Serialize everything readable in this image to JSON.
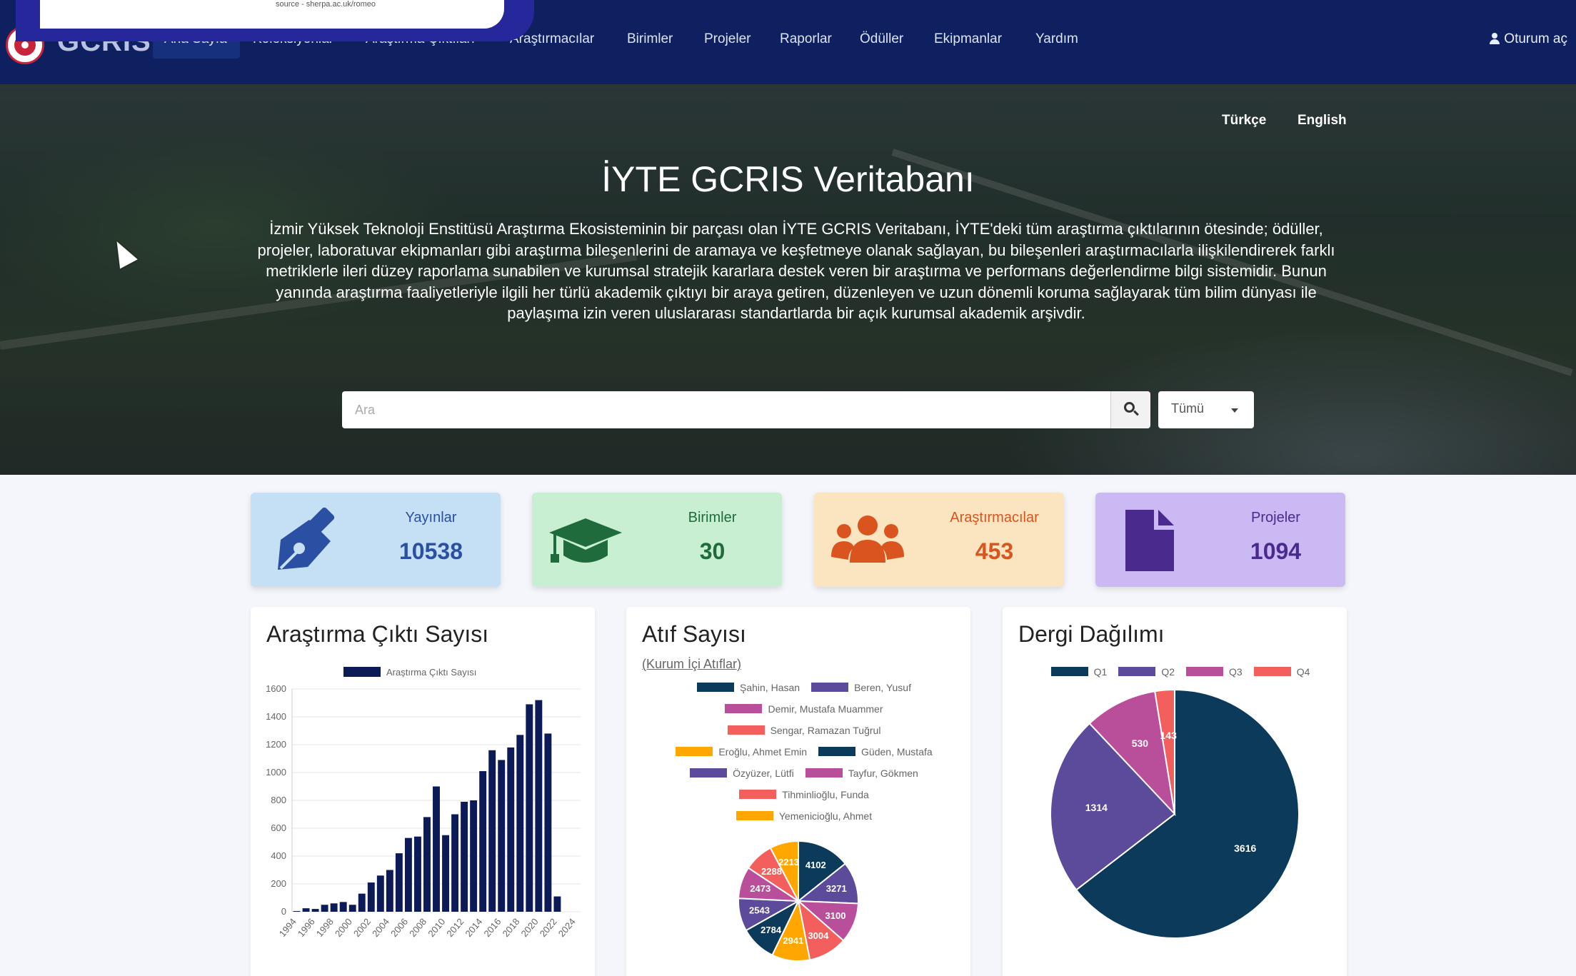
{
  "navbar": {
    "brand": "GCRIS",
    "items": [
      {
        "label": "Ana Sayfa"
      },
      {
        "label": "Koleksiyonlar"
      },
      {
        "label": "Araştırma Çıktıları"
      },
      {
        "label": "Araştırmacılar"
      },
      {
        "label": "Birimler"
      },
      {
        "label": "Projeler"
      },
      {
        "label": "Raporlar"
      },
      {
        "label": "Ödüller"
      },
      {
        "label": "Ekipmanlar"
      },
      {
        "label": "Yardım"
      }
    ],
    "login_label": "Oturum aç"
  },
  "popup": {
    "source_text": "source - sherpa.ac.uk/romeo"
  },
  "hero": {
    "lang_tr": "Türkçe",
    "lang_en": "English",
    "title": "İYTE GCRIS Veritabanı",
    "description": "İzmir Yüksek Teknoloji Enstitüsü Araştırma Ekosisteminin bir parçası olan İYTE GCRIS Veritabanı, İYTE'deki tüm araştırma çıktılarının ötesinde; ödüller, projeler, laboratuvar ekipmanları gibi araştırma bileşenlerini de aramaya ve keşfetmeye olanak sağlayan, bu bileşenleri araştırmacılarla ilişkilendirerek farklı metriklerle ileri düzey raporlama sunabilen ve kurumsal stratejik kararlara destek veren bir araştırma ve performans değerlendirme bilgi sistemidir. Bunun yanında araştırma faaliyetleriyle ilgili her türlü akademik çıktıyı bir araya getiren, düzenleyen ve uzun dönemli koruma sağlayarak tüm bilim dünyası ile paylaşıma izin veren uluslararası standartlarda bir açık kurumsal akademik arşivdir.",
    "search_placeholder": "Ara",
    "scope_selected": "Tümü"
  },
  "stats": [
    {
      "label": "Yayınlar",
      "value": "10538",
      "icon": "pen-nib-icon",
      "bg": "#c5dff5",
      "fg": "#2a4fa3"
    },
    {
      "label": "Birimler",
      "value": "30",
      "icon": "graduation-cap-icon",
      "bg": "#c9efd3",
      "fg": "#1f6b3b"
    },
    {
      "label": "Araştırmacılar",
      "value": "453",
      "icon": "users-icon",
      "bg": "#fbe4c0",
      "fg": "#d9541e"
    },
    {
      "label": "Projeler",
      "value": "1094",
      "icon": "file-icon",
      "bg": "#cbb9f3",
      "fg": "#4b2a8e"
    }
  ],
  "panels": {
    "research_output": {
      "title": "Araştırma Çıktı Sayısı"
    },
    "citations": {
      "title": "Atıf Sayısı",
      "subtitle": "(Kurum İçi Atıflar)"
    },
    "journal": {
      "title": "Dergi Dağılımı"
    }
  },
  "chart_data": [
    {
      "type": "bar",
      "legend": [
        "Araştırma Çıktı Sayısı"
      ],
      "categories": [
        "1994",
        "1995",
        "1996",
        "1997",
        "1998",
        "1999",
        "2000",
        "2001",
        "2002",
        "2003",
        "2004",
        "2005",
        "2006",
        "2007",
        "2008",
        "2009",
        "2010",
        "2011",
        "2012",
        "2013",
        "2014",
        "2015",
        "2016",
        "2017",
        "2018",
        "2019",
        "2020",
        "2021",
        "2022",
        "2023",
        "2024"
      ],
      "tick_labels": [
        "1994",
        "1996",
        "1998",
        "2000",
        "2002",
        "2004",
        "2006",
        "2008",
        "2010",
        "2012",
        "2014",
        "2016",
        "2018",
        "2020",
        "2022",
        "2024"
      ],
      "values": [
        5,
        25,
        20,
        50,
        60,
        70,
        50,
        130,
        210,
        260,
        300,
        420,
        530,
        540,
        680,
        900,
        550,
        700,
        790,
        800,
        1010,
        1160,
        1090,
        1180,
        1270,
        1490,
        1520,
        1280,
        110,
        0,
        0
      ],
      "ylim": [
        0,
        1600
      ],
      "yticks": [
        0,
        200,
        400,
        600,
        800,
        1000,
        1200,
        1400,
        1600
      ],
      "color": "#0c1a57",
      "grid": true
    },
    {
      "type": "pie",
      "legend": [
        {
          "name": "Şahin, Hasan",
          "color": "#0c3a5a"
        },
        {
          "name": "Beren, Yusuf",
          "color": "#5b4b9a"
        },
        {
          "name": "Demir, Mustafa Muammer",
          "color": "#b94f9b"
        },
        {
          "name": "Sengar, Ramazan Tuğrul",
          "color": "#f25f5c"
        },
        {
          "name": "Eroğlu, Ahmet Emin",
          "color": "#ffa600"
        },
        {
          "name": "Güden, Mustafa",
          "color": "#0c3a5a"
        },
        {
          "name": "Özyüzer, Lütfi",
          "color": "#5b4b9a"
        },
        {
          "name": "Tayfur, Gökmen",
          "color": "#b94f9b"
        },
        {
          "name": "Tihminlioğlu, Funda",
          "color": "#f25f5c"
        },
        {
          "name": "Yemenicioğlu, Ahmet",
          "color": "#ffa600"
        }
      ],
      "values": [
        4102,
        3271,
        3100,
        3004,
        2941,
        2784,
        2543,
        2473,
        2288,
        2213
      ],
      "labels": [
        "4102",
        "3271",
        "3100",
        "3004",
        "2941",
        "2784",
        "2543",
        "2473",
        "2288",
        "2213"
      ]
    },
    {
      "type": "pie",
      "legend": [
        {
          "name": "Q1",
          "color": "#0c3a5a"
        },
        {
          "name": "Q2",
          "color": "#5b4b9a"
        },
        {
          "name": "Q3",
          "color": "#b94f9b"
        },
        {
          "name": "Q4",
          "color": "#f25f5c"
        }
      ],
      "values": [
        3616,
        1314,
        530,
        143
      ],
      "labels": [
        "3616",
        "1314",
        "530",
        "143"
      ]
    }
  ]
}
